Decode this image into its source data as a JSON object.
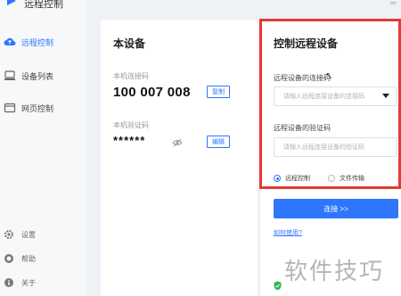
{
  "app": {
    "name": "远程控制"
  },
  "sidebar": {
    "items": [
      {
        "label": "远程控制",
        "icon": "cloud-icon",
        "active": true
      },
      {
        "label": "设备列表",
        "icon": "devices-icon",
        "active": false
      },
      {
        "label": "网页控制",
        "icon": "web-icon",
        "active": false
      }
    ],
    "bottom": [
      {
        "label": "设置",
        "icon": "gear-icon"
      },
      {
        "label": "帮助",
        "icon": "help-icon"
      },
      {
        "label": "关于",
        "icon": "info-icon"
      }
    ]
  },
  "this_device": {
    "title": "本设备",
    "id_label": "本机连接码",
    "id_value": "100 007 008",
    "copy_label": "复制",
    "code_label": "本机验证码",
    "code_value": "******",
    "edit_label": "编辑"
  },
  "remote": {
    "title": "控制远程设备",
    "id_label": "远程设备的连接码",
    "id_placeholder": "请输入远程连接设备的连接码",
    "code_label": "远程设备的验证码",
    "code_placeholder": "请输入远程连接设备的验证码",
    "mode_control": "远程控制",
    "mode_transfer": "文件传输",
    "selected_mode": "远程控制",
    "connect_label": "连接 >>",
    "help_link": "如何使用?"
  },
  "watermark": "软件技巧",
  "colors": {
    "accent": "#2f76ff",
    "highlight": "#e53935"
  }
}
